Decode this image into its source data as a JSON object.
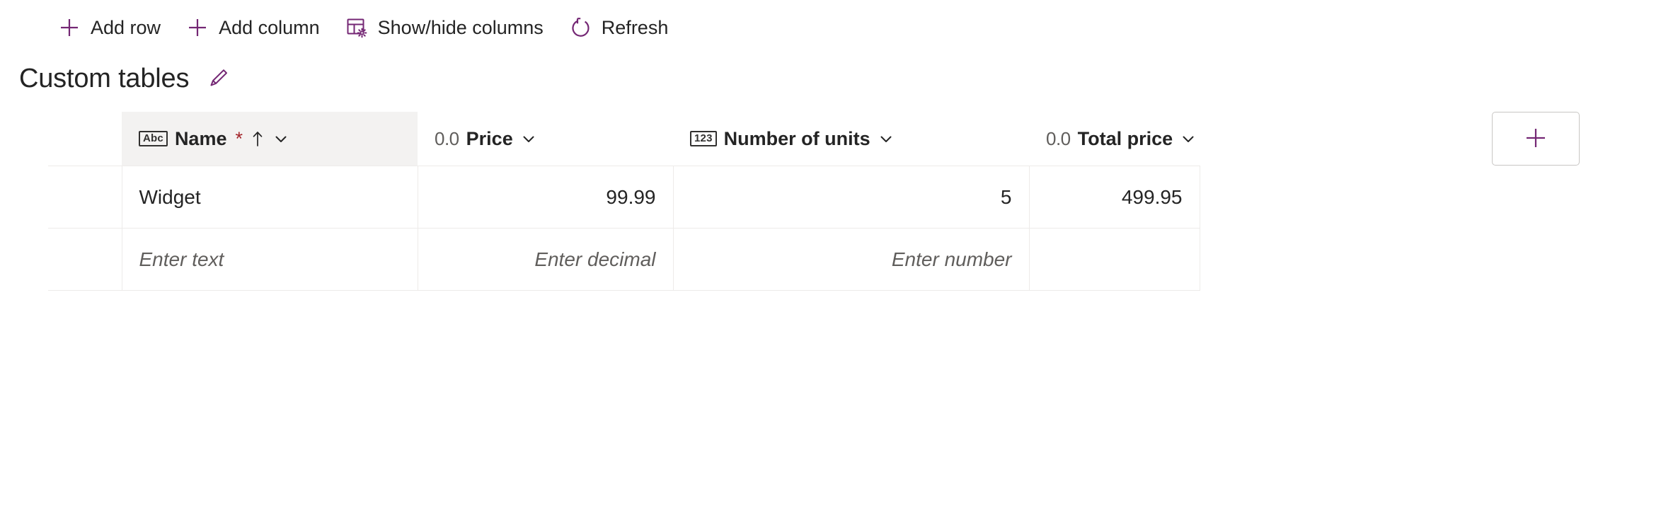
{
  "theme": {
    "accent_purple": "#742774",
    "text_primary": "#242424",
    "text_secondary": "#605e5c",
    "required_red": "#a4262c",
    "header_bg": "#f3f2f1",
    "border": "#edebe9",
    "button_border": "#c8c6c4"
  },
  "commandbar": {
    "buttons": [
      {
        "label": "Add row",
        "icon": "plus-icon"
      },
      {
        "label": "Add column",
        "icon": "plus-icon"
      },
      {
        "label": "Show/hide columns",
        "icon": "table-settings-icon"
      },
      {
        "label": "Refresh",
        "icon": "refresh-icon"
      }
    ]
  },
  "header": {
    "title": "Custom tables",
    "edit_icon": "pencil-icon"
  },
  "grid": {
    "columns": [
      {
        "label": "Name",
        "type_icon": "abc-icon",
        "type_icon_text": "Abc",
        "required": true,
        "required_marker": "*",
        "sorted": true,
        "sort_direction": "ascending",
        "align": "left",
        "selected": true,
        "placeholder": "Enter text"
      },
      {
        "label": "Price",
        "type_icon": "decimal-icon",
        "type_icon_text": "0.0",
        "required": false,
        "required_marker": "",
        "sorted": false,
        "sort_direction": "",
        "align": "right",
        "selected": false,
        "placeholder": "Enter decimal"
      },
      {
        "label": "Number of units",
        "type_icon": "number-icon",
        "type_icon_text": "123",
        "required": false,
        "required_marker": "",
        "sorted": false,
        "sort_direction": "",
        "align": "right",
        "selected": false,
        "placeholder": "Enter number"
      },
      {
        "label": "Total price",
        "type_icon": "decimal-icon",
        "type_icon_text": "0.0",
        "required": false,
        "required_marker": "",
        "sorted": false,
        "sort_direction": "",
        "align": "right",
        "selected": false,
        "placeholder": ""
      }
    ],
    "rows": [
      {
        "name": "Widget",
        "price": "99.99",
        "units": "5",
        "total": "499.95"
      }
    ],
    "new_row": {
      "name": "",
      "price": "",
      "units": "",
      "total": ""
    },
    "add_column_button": {
      "icon": "plus-icon",
      "label": ""
    }
  }
}
